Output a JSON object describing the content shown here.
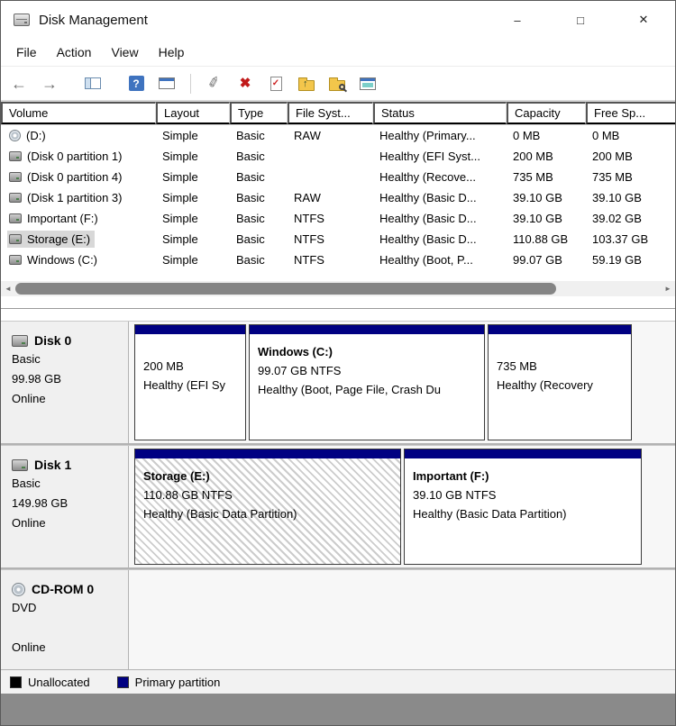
{
  "window": {
    "title": "Disk Management",
    "minimize_glyph": "–",
    "maximize_glyph": "□",
    "close_glyph": "✕"
  },
  "menu": {
    "items": [
      "File",
      "Action",
      "View",
      "Help"
    ]
  },
  "toolbar": {
    "back_glyph": "←",
    "forward_glyph": "→",
    "help_glyph": "?",
    "wand_glyph": "✐",
    "delete_glyph": "✖",
    "check_glyph": "✓",
    "up_arrow_glyph": "↑"
  },
  "table": {
    "columns": [
      "Volume",
      "Layout",
      "Type",
      "File Syst...",
      "Status",
      "Capacity",
      "Free Sp..."
    ],
    "rows": [
      {
        "volume": "(D:)",
        "layout": "Simple",
        "type": "Basic",
        "file_system": "RAW",
        "status": "Healthy (Primary...",
        "capacity": "0 MB",
        "free_space": "0 MB"
      },
      {
        "volume": "(Disk 0 partition 1)",
        "layout": "Simple",
        "type": "Basic",
        "file_system": "",
        "status": "Healthy (EFI Syst...",
        "capacity": "200 MB",
        "free_space": "200 MB"
      },
      {
        "volume": "(Disk 0 partition 4)",
        "layout": "Simple",
        "type": "Basic",
        "file_system": "",
        "status": "Healthy (Recove...",
        "capacity": "735 MB",
        "free_space": "735 MB"
      },
      {
        "volume": "(Disk 1 partition 3)",
        "layout": "Simple",
        "type": "Basic",
        "file_system": "RAW",
        "status": "Healthy (Basic D...",
        "capacity": "39.10 GB",
        "free_space": "39.10 GB"
      },
      {
        "volume": "Important (F:)",
        "layout": "Simple",
        "type": "Basic",
        "file_system": "NTFS",
        "status": "Healthy (Basic D...",
        "capacity": "39.10 GB",
        "free_space": "39.02 GB"
      },
      {
        "volume": "Storage (E:)",
        "layout": "Simple",
        "type": "Basic",
        "file_system": "NTFS",
        "status": "Healthy (Basic D...",
        "capacity": "110.88 GB",
        "free_space": "103.37 GB"
      },
      {
        "volume": "Windows (C:)",
        "layout": "Simple",
        "type": "Basic",
        "file_system": "NTFS",
        "status": "Healthy (Boot, P...",
        "capacity": "99.07 GB",
        "free_space": "59.19 GB"
      }
    ]
  },
  "disks": [
    {
      "name": "Disk 0",
      "type": "Basic",
      "size": "99.98 GB",
      "status": "Online",
      "partitions": [
        {
          "title": "",
          "size_line": "200 MB",
          "status_line": "Healthy (EFI Sy"
        },
        {
          "title": "Windows  (C:)",
          "size_line": "99.07 GB NTFS",
          "status_line": "Healthy (Boot, Page File, Crash Du"
        },
        {
          "title": "",
          "size_line": "735 MB",
          "status_line": "Healthy (Recovery"
        }
      ]
    },
    {
      "name": "Disk 1",
      "type": "Basic",
      "size": "149.98 GB",
      "status": "Online",
      "partitions": [
        {
          "title": "Storage  (E:)",
          "size_line": "110.88 GB NTFS",
          "status_line": "Healthy (Basic Data Partition)"
        },
        {
          "title": "Important  (F:)",
          "size_line": "39.10 GB NTFS",
          "status_line": "Healthy (Basic Data Partition)"
        }
      ]
    },
    {
      "name": "CD-ROM 0",
      "type": "DVD",
      "size": "",
      "status": "Online",
      "partitions": []
    }
  ],
  "legend": {
    "items": [
      {
        "label": "Unallocated",
        "color": "#000000"
      },
      {
        "label": "Primary partition",
        "color": "#000082"
      }
    ]
  },
  "colors": {
    "primary_partition": "#000082",
    "unallocated": "#000000"
  }
}
